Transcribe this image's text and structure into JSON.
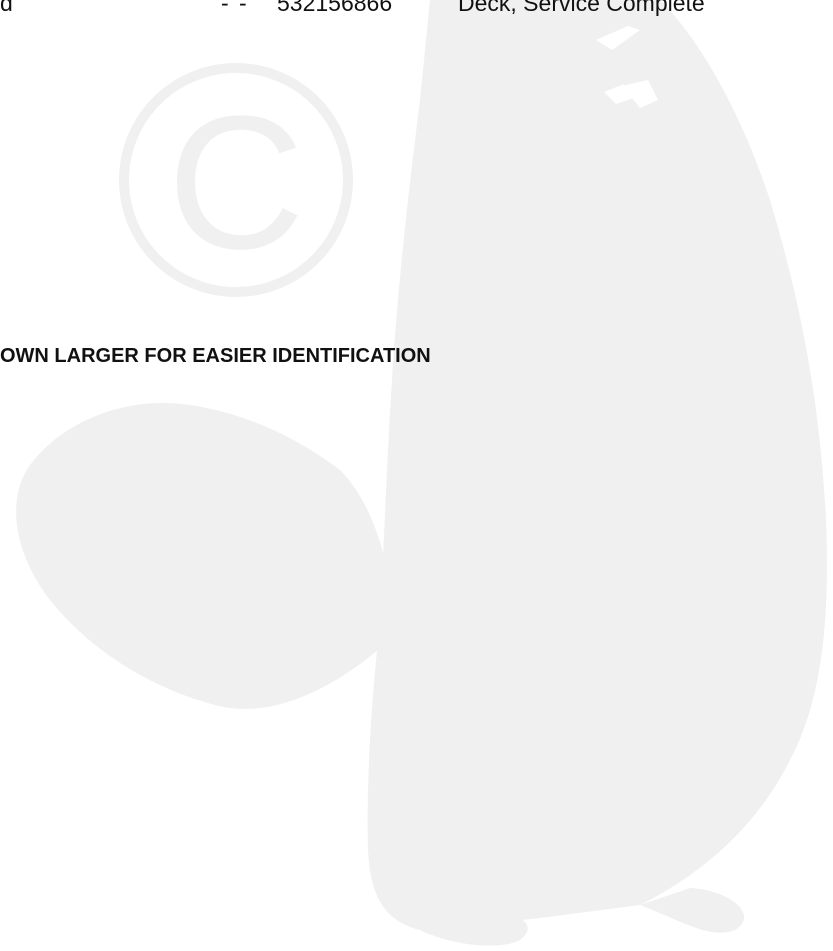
{
  "table_row_partial": {
    "col1_fragment": "d",
    "col2_fragment": "- -",
    "part_number": "532156866",
    "description": "Deck, Service Complete"
  },
  "section_heading": "OWN LARGER FOR EASIER IDENTIFICATION",
  "watermark": {
    "type": "beaver-silhouette-with-copyright-symbol",
    "color": "#f0f0f0"
  }
}
